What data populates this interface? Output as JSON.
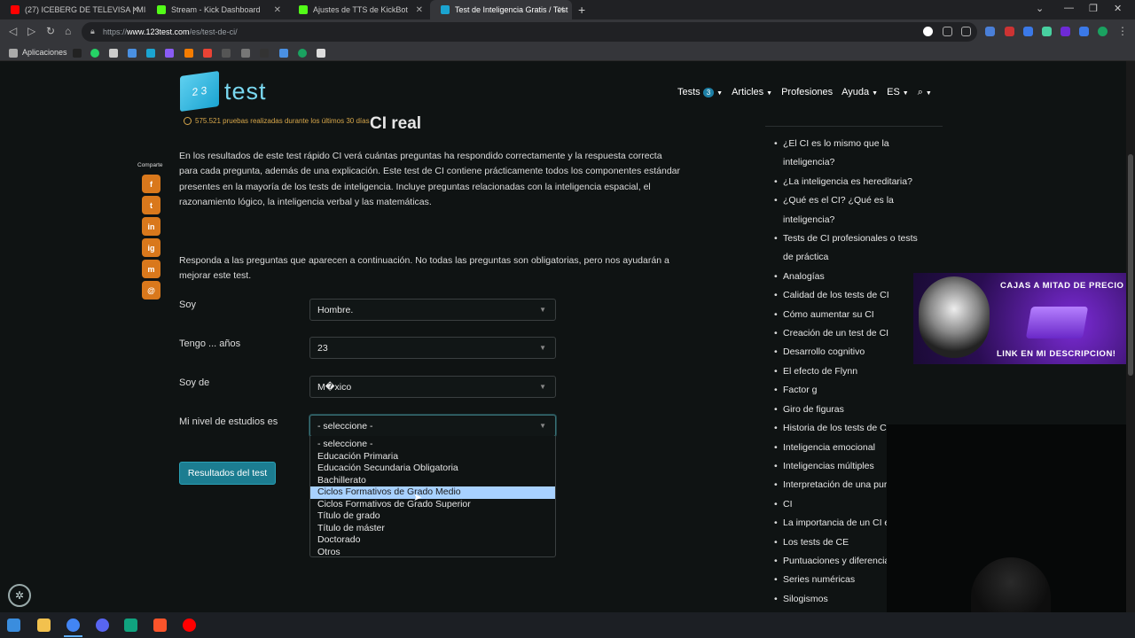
{
  "browser": {
    "tabs": [
      {
        "title": "(27) ICEBERG DE TELEVISA | MIS",
        "color": "#ff0000"
      },
      {
        "title": "Stream - Kick Dashboard",
        "color": "#53fc18"
      },
      {
        "title": "Ajustes de TTS de KickBot",
        "color": "#53fc18"
      },
      {
        "title": "Test de Inteligencia Gratis / Test",
        "color": "#1ba4d1"
      }
    ],
    "url_prefix": "https://",
    "url_host": "www.123test.com",
    "url_path": "/es/test-de-ci/",
    "bookmarks_label": "Aplicaciones"
  },
  "site": {
    "logo_text": "test",
    "logo_cube": "2 3",
    "tests_count_text": "575.521 pruebas realizadas durante los últimos 30 días",
    "heading_tail": "CI real",
    "nav": {
      "tests": "Tests",
      "tests_badge": "3",
      "articles": "Articles",
      "profesiones": "Profesiones",
      "ayuda": "Ayuda",
      "lang": "ES"
    }
  },
  "intro_text": "En los resultados de este test rápido CI verá cuántas preguntas ha respondido correctamente y la respuesta correcta para cada pregunta, además de una explicación. Este test de CI contiene prácticamente todos los componentes estándar presentes en la mayoría de los tests de inteligencia. Incluye preguntas relacionadas con la inteligencia espacial, el razonamiento lógico, la inteligencia verbal y las matemáticas.",
  "instructions_text": "Responda a las preguntas que aparecen a continuación. No todas las preguntas son obligatorias, pero nos ayudarán a mejorar este test.",
  "share": {
    "label": "Comparte",
    "buttons": [
      "f",
      "t",
      "in",
      "ig",
      "m",
      "@"
    ]
  },
  "form": {
    "soy_label": "Soy",
    "soy_value": "Hombre.",
    "edad_label": "Tengo ... años",
    "edad_value": "23",
    "pais_label": "Soy de",
    "pais_value": "M�xico",
    "estudios_label": "Mi nivel de estudios es",
    "estudios_value": "- seleccione -",
    "estudios_options": [
      "- seleccione -",
      "Educación Primaria",
      "Educación Secundaria Obligatoria",
      "Bachillerato",
      "Ciclos Formativos de Grado Medio",
      "Ciclos Formativos de Grado Superior",
      "Título de grado",
      "Título de máster",
      "Doctorado",
      "Otros"
    ],
    "highlighted_option": "Ciclos Formativos de Grado Medio",
    "submit_label": "Resultados del test"
  },
  "sidebar": {
    "items": [
      "¿El CI es lo mismo que la inteligencia?",
      "¿La inteligencia es hereditaria?",
      "¿Qué es el CI? ¿Qué es la inteligencia?",
      "Tests de CI profesionales o tests de práctica",
      "Analogías",
      "Calidad de los tests de CI",
      "Cómo aumentar su CI",
      "Creación de un test de CI",
      "Desarrollo cognitivo",
      "El efecto de Flynn",
      "Factor g",
      "Giro de figuras",
      "Historia de los tests de C",
      "Inteligencia emocional",
      "Inteligencias múltiples",
      "Interpretación de una pur",
      "CI",
      "La importancia de un CI e",
      "Los tests de CE",
      "Puntuaciones y diferencia",
      "Series numéricas",
      "Silogismos"
    ]
  },
  "promo": {
    "title": "CAJAS A MITAD DE PRECIO",
    "link": "LINK EN MI DESCRIPCION!"
  }
}
